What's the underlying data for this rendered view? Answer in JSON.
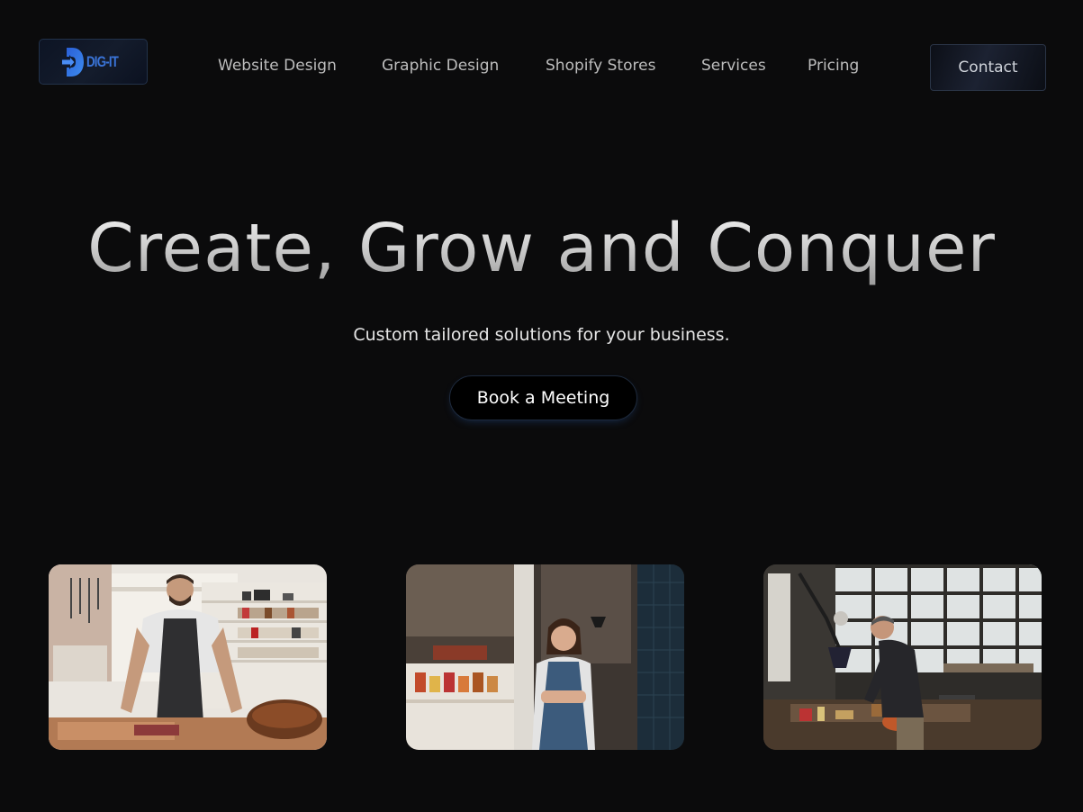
{
  "brand": {
    "logo_text": "DIG-IT",
    "logo_color": "#3a74d8"
  },
  "nav": {
    "items": [
      {
        "label": "Website Design"
      },
      {
        "label": "Graphic Design"
      },
      {
        "label": "Shopify Stores"
      },
      {
        "label": "Services"
      },
      {
        "label": "Pricing"
      }
    ],
    "contact_label": "Contact"
  },
  "hero": {
    "title": "Create, Grow and Conquer",
    "subtitle": "Custom tailored solutions for your business.",
    "cta_label": "Book a Meeting"
  },
  "gallery": {
    "images": [
      {
        "icon": "leather-craftsman-photo"
      },
      {
        "icon": "shop-owner-photo"
      },
      {
        "icon": "workshop-artisan-photo"
      }
    ]
  },
  "colors": {
    "background": "#0b0b0c",
    "accent": "#3a74d8"
  }
}
